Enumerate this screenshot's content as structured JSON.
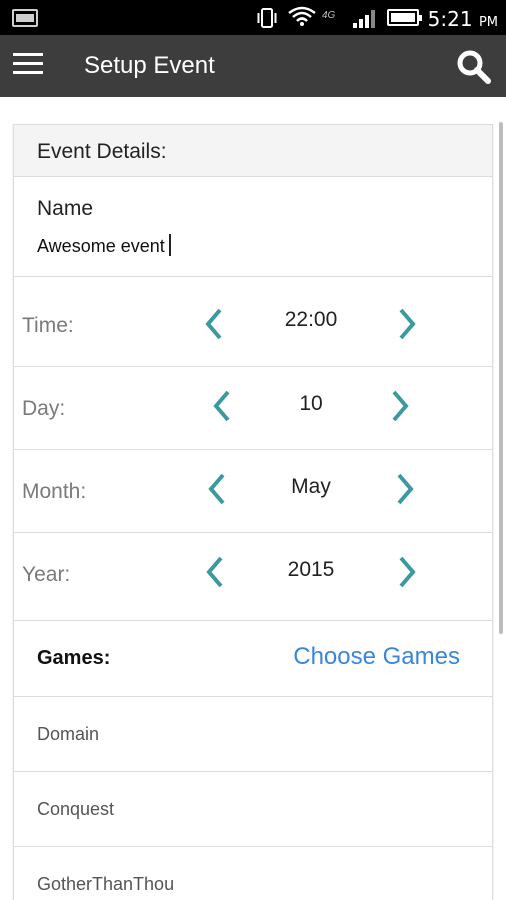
{
  "status_bar": {
    "time": "5:21",
    "ampm": "PM",
    "network_label": "4G"
  },
  "app_bar": {
    "title": "Setup Event",
    "menu_icon": "hamburger-icon",
    "search_icon": "search-icon"
  },
  "card": {
    "header": "Event Details:",
    "name": {
      "label": "Name",
      "value": "Awesome event"
    },
    "pickers": [
      {
        "label": "Time:",
        "value": "22:00"
      },
      {
        "label": "Day:",
        "value": "10"
      },
      {
        "label": "Month:",
        "value": "May"
      },
      {
        "label": "Year:",
        "value": "2015"
      }
    ],
    "games": {
      "label": "Games:",
      "action": "Choose Games",
      "items": [
        "Domain",
        "Conquest",
        "GotherThanThou"
      ]
    }
  },
  "colors": {
    "accent_teal": "#3b9aa0",
    "link_blue": "#3a86d8",
    "app_bar_bg": "#3d3d3d"
  }
}
